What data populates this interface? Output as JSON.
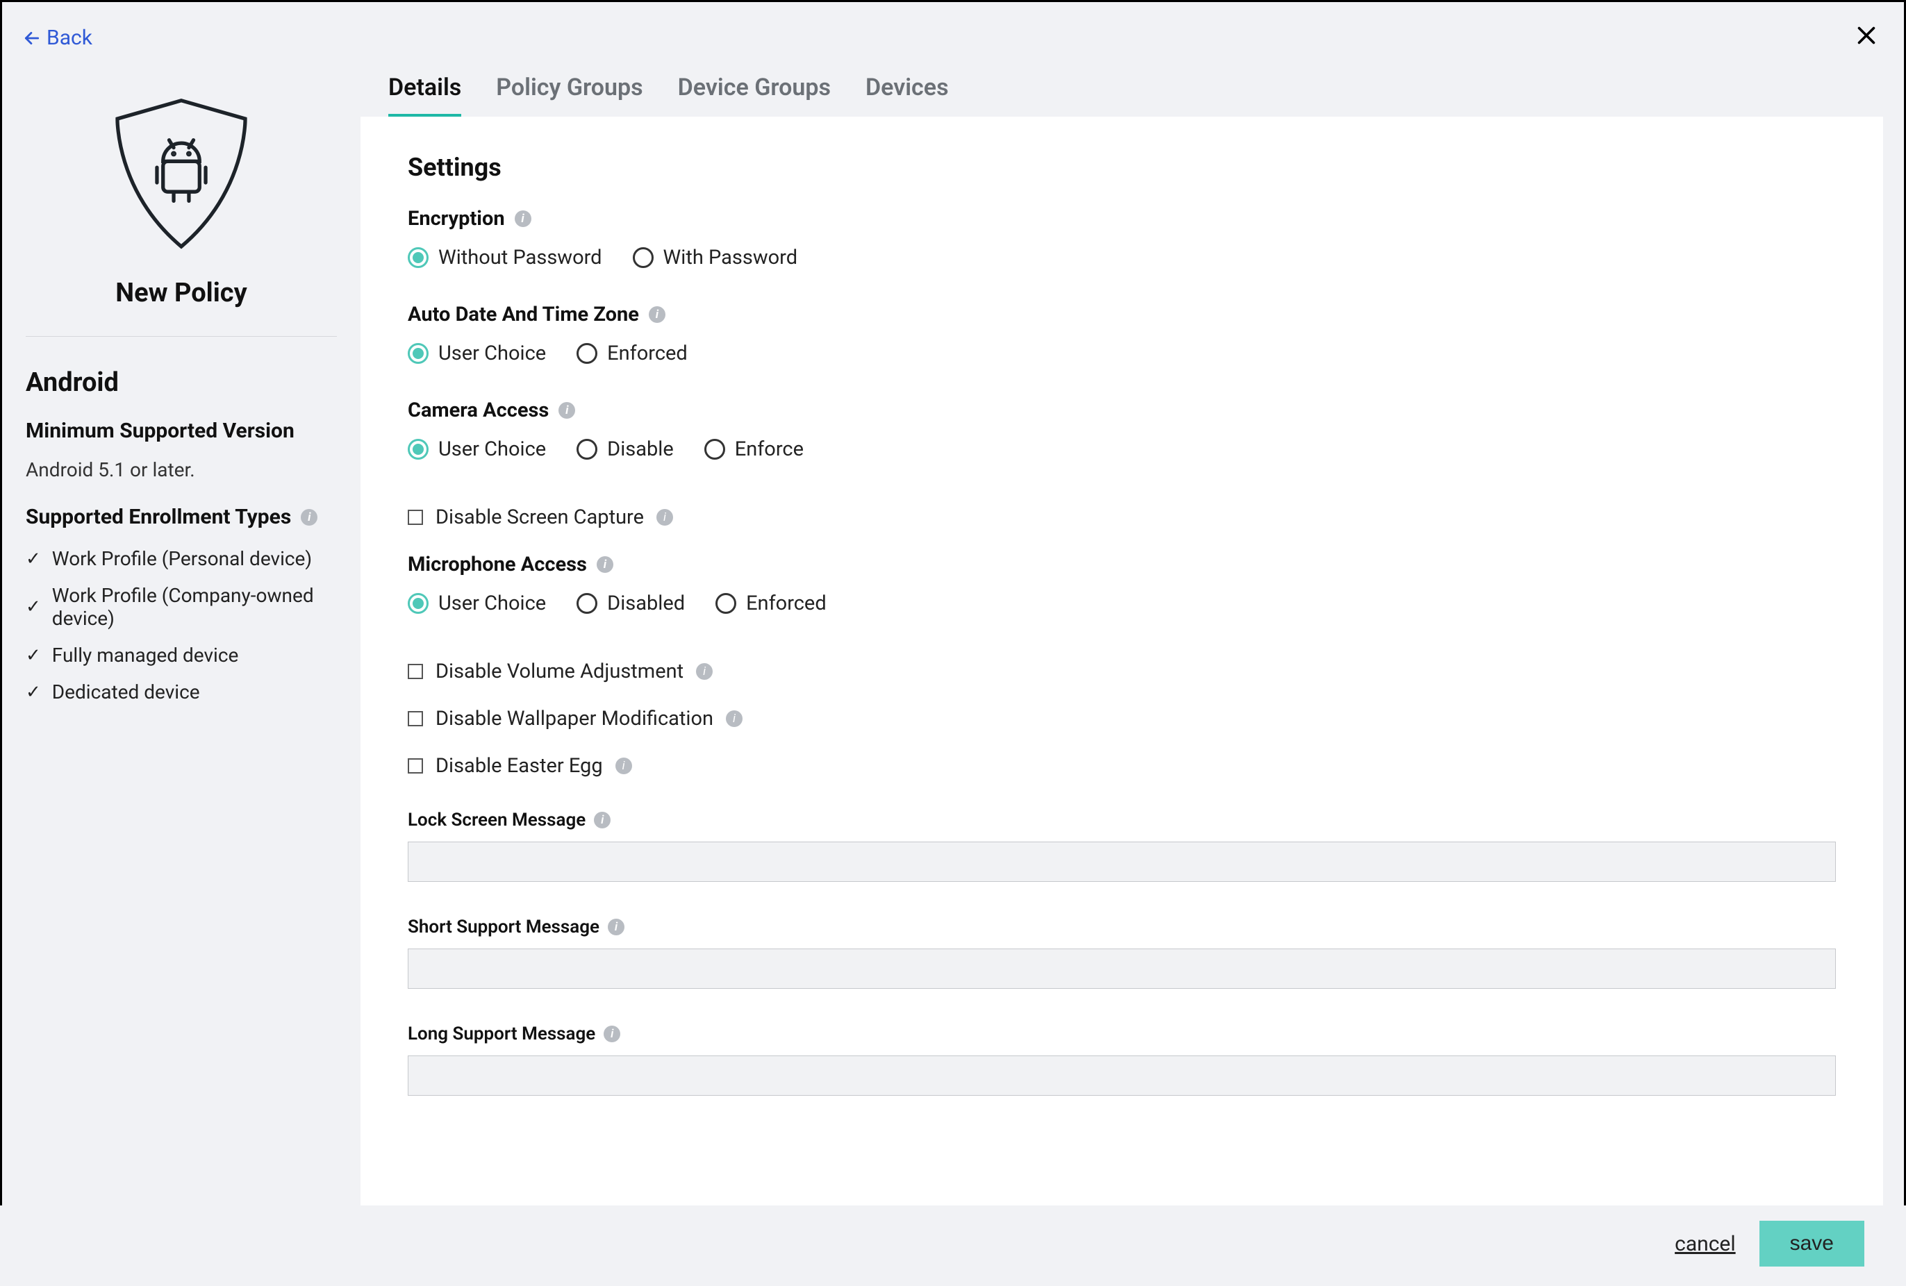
{
  "back_label": "Back",
  "sidebar": {
    "policy_title": "New Policy",
    "platform": "Android",
    "min_version_heading": "Minimum Supported Version",
    "min_version_text": "Android 5.1 or later.",
    "enrollment_heading": "Supported Enrollment Types",
    "enrollment_types": [
      "Work Profile (Personal device)",
      "Work Profile (Company-owned device)",
      "Fully managed device",
      "Dedicated device"
    ]
  },
  "tabs": [
    "Details",
    "Policy Groups",
    "Device Groups",
    "Devices"
  ],
  "active_tab": 0,
  "section_title": "Settings",
  "fields": {
    "encryption": {
      "label": "Encryption",
      "options": [
        "Without Password",
        "With Password"
      ],
      "selected": 0
    },
    "auto_tz": {
      "label": "Auto Date And Time Zone",
      "options": [
        "User Choice",
        "Enforced"
      ],
      "selected": 0
    },
    "camera": {
      "label": "Camera Access",
      "options": [
        "User Choice",
        "Disable",
        "Enforce"
      ],
      "selected": 0
    },
    "screen_capture": {
      "label": "Disable Screen Capture",
      "checked": false
    },
    "microphone": {
      "label": "Microphone Access",
      "options": [
        "User Choice",
        "Disabled",
        "Enforced"
      ],
      "selected": 0
    },
    "volume": {
      "label": "Disable Volume Adjustment",
      "checked": false
    },
    "wallpaper": {
      "label": "Disable Wallpaper Modification",
      "checked": false
    },
    "easter_egg": {
      "label": "Disable Easter Egg",
      "checked": false
    },
    "lock_msg": {
      "label": "Lock Screen Message",
      "value": ""
    },
    "short_msg": {
      "label": "Short Support Message",
      "value": ""
    },
    "long_msg": {
      "label": "Long Support Message",
      "value": ""
    }
  },
  "footer": {
    "cancel": "cancel",
    "save": "save"
  }
}
